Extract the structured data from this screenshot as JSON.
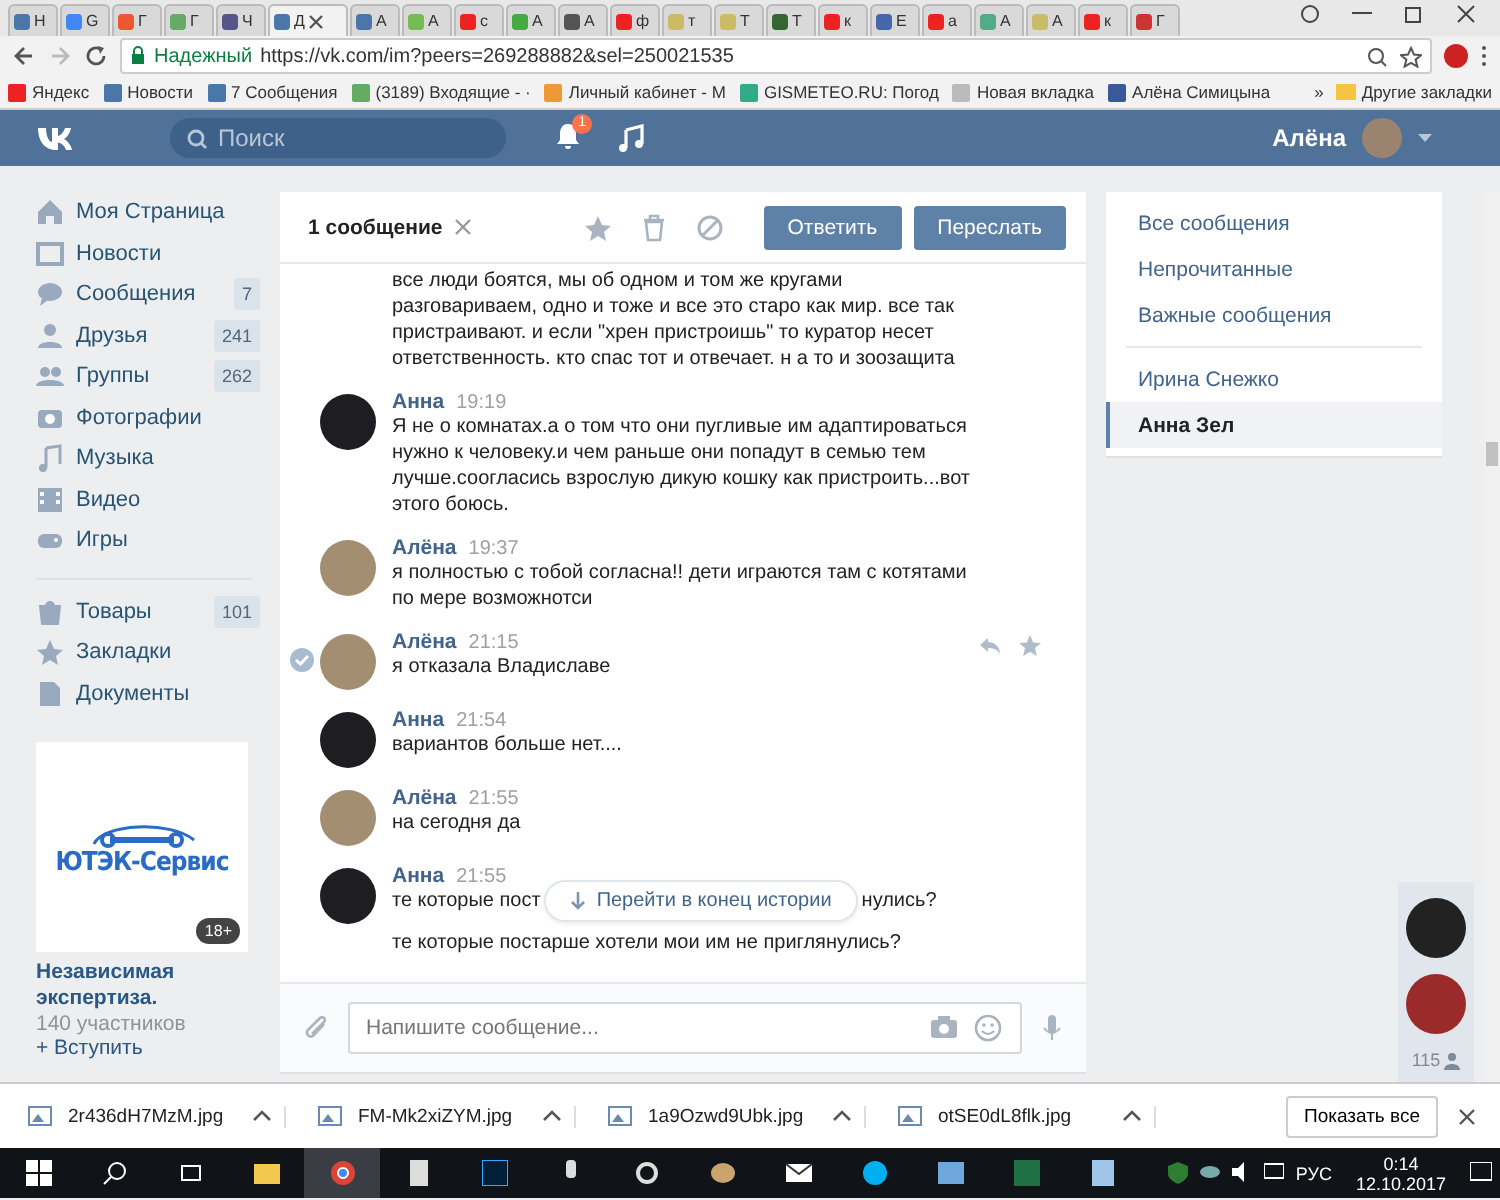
{
  "browser": {
    "tabs": [
      {
        "label": "Н",
        "selected": false
      },
      {
        "label": "G",
        "selected": false
      },
      {
        "label": "Г",
        "selected": false
      },
      {
        "label": "Г",
        "selected": false
      },
      {
        "label": "Ч",
        "selected": false
      },
      {
        "label": "Д",
        "selected": true
      },
      {
        "label": "А",
        "selected": false
      },
      {
        "label": "А",
        "selected": false
      },
      {
        "label": "с",
        "selected": false
      },
      {
        "label": "А",
        "selected": false
      },
      {
        "label": "А",
        "selected": false
      },
      {
        "label": "ф",
        "selected": false
      },
      {
        "label": "т",
        "selected": false
      },
      {
        "label": "Т",
        "selected": false
      },
      {
        "label": "Т",
        "selected": false
      },
      {
        "label": "к",
        "selected": false
      },
      {
        "label": "Е",
        "selected": false
      },
      {
        "label": "а",
        "selected": false
      },
      {
        "label": "А",
        "selected": false
      },
      {
        "label": "А",
        "selected": false
      },
      {
        "label": "к",
        "selected": false
      },
      {
        "label": "Г",
        "selected": false
      }
    ],
    "security_label": "Надежный",
    "url": "https://vk.com/im?peers=269288882&sel=250021535",
    "bookmarks": [
      "Яндекс",
      "Новости",
      "7 Сообщения",
      "(3189) Входящие - ·",
      "Личный кабинет - М",
      "GISMETEO.RU: Погод",
      "Новая вкладка",
      "Алёна Симицына"
    ],
    "more_bookmarks": "»",
    "other_bookmarks": "Другие закладки"
  },
  "vk_header": {
    "search_placeholder": "Поиск",
    "notifications_badge": "1",
    "user_name": "Алёна"
  },
  "left_nav": {
    "items": [
      {
        "label": "Моя Страница"
      },
      {
        "label": "Новости"
      },
      {
        "label": "Сообщения",
        "count": "7"
      },
      {
        "label": "Друзья",
        "count": "241"
      },
      {
        "label": "Группы",
        "count": "262"
      },
      {
        "label": "Фотографии"
      },
      {
        "label": "Музыка"
      },
      {
        "label": "Видео"
      },
      {
        "label": "Игры"
      }
    ],
    "items_more": [
      {
        "label": "Товары",
        "count": "101"
      },
      {
        "label": "Закладки"
      },
      {
        "label": "Документы"
      }
    ]
  },
  "ad": {
    "logo_text": "ЮТЭК-Сервис",
    "age_badge": "18+",
    "title": "Независимая экспертиза.",
    "members": "140 участников",
    "join": "+ Вступить"
  },
  "chat": {
    "title": "1 сообщение",
    "reply_button": "Ответить",
    "forward_button": "Переслать",
    "messages": [
      {
        "kind": "continuation",
        "text": "все люди боятся, мы об одном и том же кругами разговариваем, одно и тоже и все это старо как мир. все так пристраивают. и если \"хрен пристроишь\" то куратор несет ответственность. кто спас тот и отвечает. н а то и зоозащита"
      },
      {
        "kind": "message",
        "own": false,
        "selected": false,
        "author": "Анна",
        "time": "19:19",
        "text": "Я не о комнатах.а о том что они пугливые им адаптироваться нужно к человеку.и чем раньше они попадут в семью тем лучше.соогласись взрослую дикую кошку как пристроить...вот этого боюсь."
      },
      {
        "kind": "message",
        "own": true,
        "selected": false,
        "author": "Алёна",
        "time": "19:37",
        "text": "я полностью с тобой согласна!! дети играются там с котятами по мере возможнотси"
      },
      {
        "kind": "message",
        "own": true,
        "selected": true,
        "author": "Алёна",
        "time": "21:15",
        "text": "я отказала Владиславе"
      },
      {
        "kind": "message",
        "own": false,
        "selected": false,
        "author": "Анна",
        "time": "21:54",
        "text": "вариантов больше нет...."
      },
      {
        "kind": "message",
        "own": true,
        "selected": false,
        "author": "Алёна",
        "time": "21:55",
        "text": "на сегодня да"
      },
      {
        "kind": "covered",
        "own": false,
        "selected": false,
        "author": "Анна",
        "time": "21:55",
        "text_start": "те которые пост",
        "text_end": "нулись?",
        "text_next": "те которые постарше хотели мои им не приглянулись?"
      }
    ],
    "jump_button": "Перейти в конец истории",
    "composer_placeholder": "Напишите сообщение..."
  },
  "right_menu": {
    "filters": [
      {
        "label": "Все сообщения",
        "selected": false
      },
      {
        "label": "Непрочитанные",
        "selected": false
      },
      {
        "label": "Важные сообщения",
        "selected": false
      }
    ],
    "dialogs": [
      {
        "label": "Ирина Снежко",
        "selected": false
      },
      {
        "label": "Анна Зел",
        "selected": true
      }
    ]
  },
  "online_strip": {
    "count": "115"
  },
  "downloads": {
    "files": [
      "2r436dH7MzM.jpg",
      "FM-Mk2xiZYM.jpg",
      "1a9Ozwd9Ubk.jpg",
      "otSE0dL8flk.jpg"
    ],
    "show_all": "Показать все"
  },
  "taskbar": {
    "language": "РУС",
    "time": "0:14",
    "date": "12.10.2017"
  }
}
